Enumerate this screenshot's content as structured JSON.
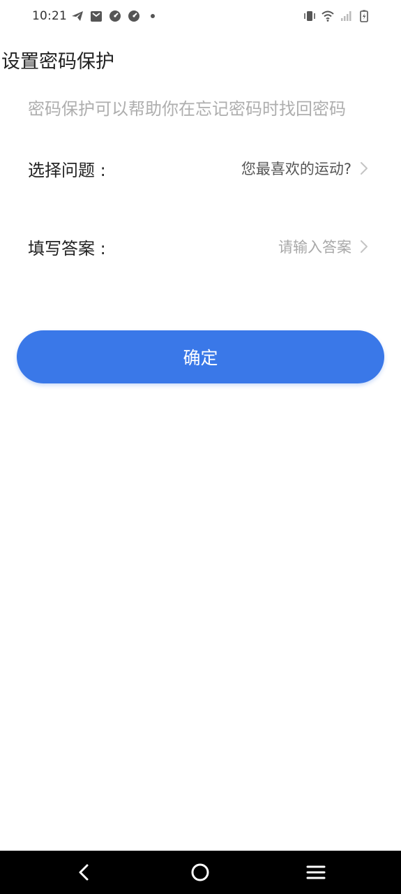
{
  "status_bar": {
    "time": "10:21",
    "left_icons": [
      "telegram-icon",
      "mail-icon",
      "speedometer-icon",
      "speedometer-icon",
      "dot-icon"
    ],
    "right_icons": [
      "vibrate-icon",
      "wifi-icon",
      "signal-icon",
      "battery-charging-icon"
    ]
  },
  "page": {
    "title": "设置密码保护",
    "subtitle": "密码保护可以帮助你在忘记密码时找回密码"
  },
  "form": {
    "question": {
      "label": "选择问题 :",
      "value": "您最喜欢的运动?"
    },
    "answer": {
      "label": "填写答案 :",
      "placeholder": "请输入答案"
    }
  },
  "confirm_button": {
    "label": "确定"
  },
  "colors": {
    "accent": "#3a78e8",
    "text_primary": "#222222",
    "text_hint": "#aeaeae",
    "nav_bar": "#000000"
  },
  "nav_bar": {
    "icons": [
      "back-icon",
      "home-icon",
      "menu-icon"
    ]
  }
}
